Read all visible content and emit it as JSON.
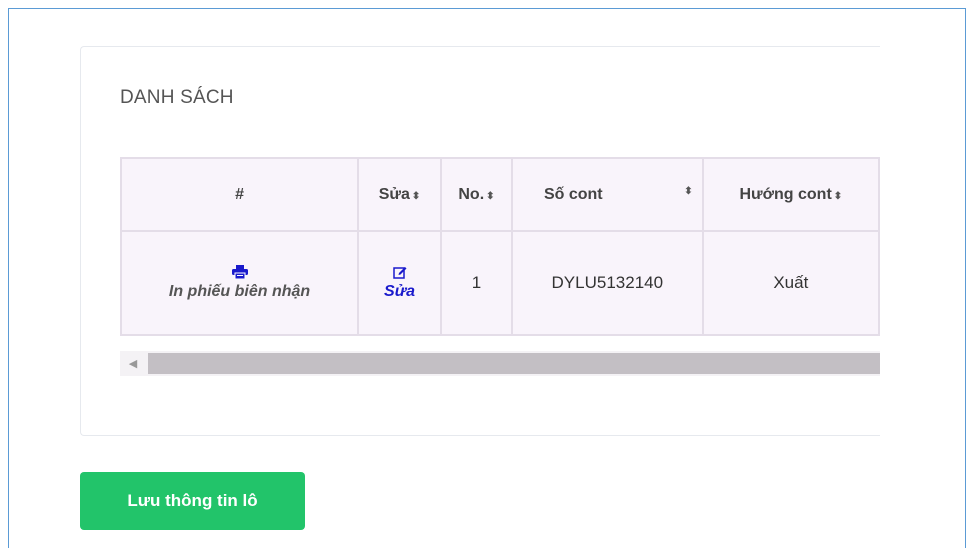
{
  "panel": {
    "title": "DANH SÁCH"
  },
  "table": {
    "headers": [
      "#",
      "Sửa",
      "No.",
      "Số cont",
      "Hướng cont"
    ],
    "rows": [
      {
        "print_label": "In phiếu biên nhận",
        "edit_label": "Sửa",
        "no": "1",
        "so_cont": "DYLU5132140",
        "huong_cont": "Xuất"
      }
    ]
  },
  "buttons": {
    "save_label": "Lưu thông tin lô"
  },
  "colors": {
    "accent_green": "#22c46a",
    "link_blue": "#1a1acc",
    "frame_blue": "#5b9bd5"
  },
  "icons": {
    "print": "print-icon",
    "edit": "edit-icon",
    "sort": "sort-icon",
    "scroll_left": "chevron-left-icon"
  }
}
